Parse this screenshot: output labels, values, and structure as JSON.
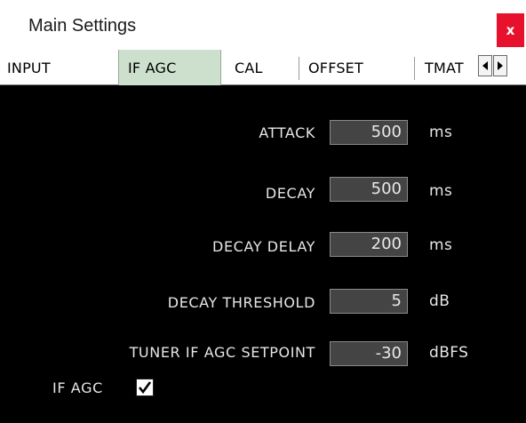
{
  "window": {
    "title": "Main Settings",
    "close_label": "x"
  },
  "tabs": [
    {
      "label": "INPUT",
      "active": false
    },
    {
      "label": "IF AGC",
      "active": true
    },
    {
      "label": "CAL",
      "active": false
    },
    {
      "label": "OFFSET",
      "active": false
    },
    {
      "label": "TMAT",
      "active": false
    }
  ],
  "settings": [
    {
      "label": "ATTACK",
      "value": "500",
      "unit": "ms"
    },
    {
      "label": "DECAY",
      "value": "500",
      "unit": "ms"
    },
    {
      "label": "DECAY DELAY",
      "value": "200",
      "unit": "ms"
    },
    {
      "label": "DECAY THRESHOLD",
      "value": "5",
      "unit": "dB"
    },
    {
      "label": "TUNER IF AGC SETPOINT",
      "value": "-30",
      "unit": "dBFS"
    }
  ],
  "if_agc": {
    "label": "IF AGC",
    "checked": true
  },
  "colors": {
    "close_bg": "#e8112d",
    "active_tab": "#cde0cd",
    "field_bg": "#444444",
    "panel_bg": "#000000"
  },
  "icons": {
    "scroll_left": "left-arrow-icon",
    "scroll_right": "right-arrow-icon",
    "check": "check-icon"
  }
}
